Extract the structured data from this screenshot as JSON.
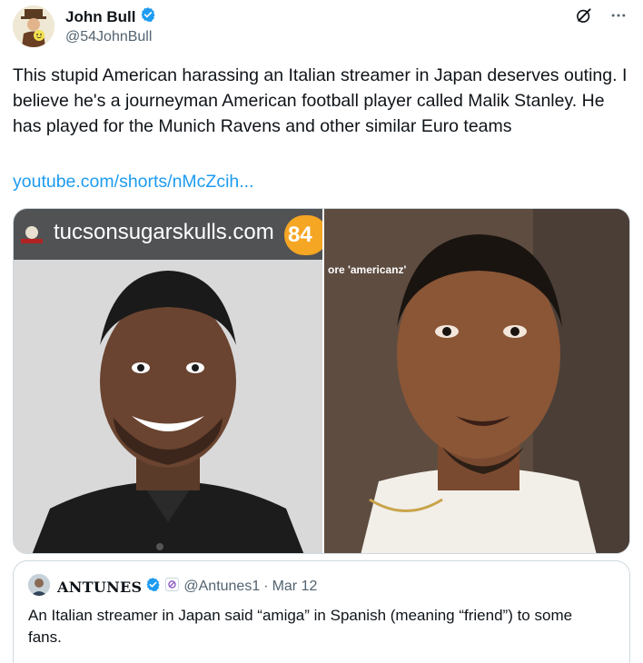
{
  "author": {
    "display_name": "John Bull",
    "handle": "@54JohnBull",
    "verified_icon": "verified-badge-icon"
  },
  "top_icons": [
    "grok-icon",
    "more-icon"
  ],
  "tweet": {
    "text": "This stupid American harassing an Italian streamer in Japan deserves outing. I believe he's a journeyman American football player called Malik Stanley. He has played for the Munich Ravens and other similar Euro teams",
    "link": "youtube.com/shorts/nMcZcih..."
  },
  "media": {
    "left_banner_text": "tucsonsugarskulls.com",
    "left_badge": "84",
    "right_caption": "ore 'americanz'"
  },
  "quoted": {
    "display_name": "ANTUNES",
    "handle": "@Antunes1",
    "separator": "·",
    "date": "Mar 12",
    "text": "An Italian streamer in Japan said “amiga” in Spanish (meaning “friend”) to some fans."
  },
  "colors": {
    "accent": "#1d9bf0",
    "text": "#0f1419",
    "secondary": "#536471",
    "border": "#cfd9de"
  }
}
